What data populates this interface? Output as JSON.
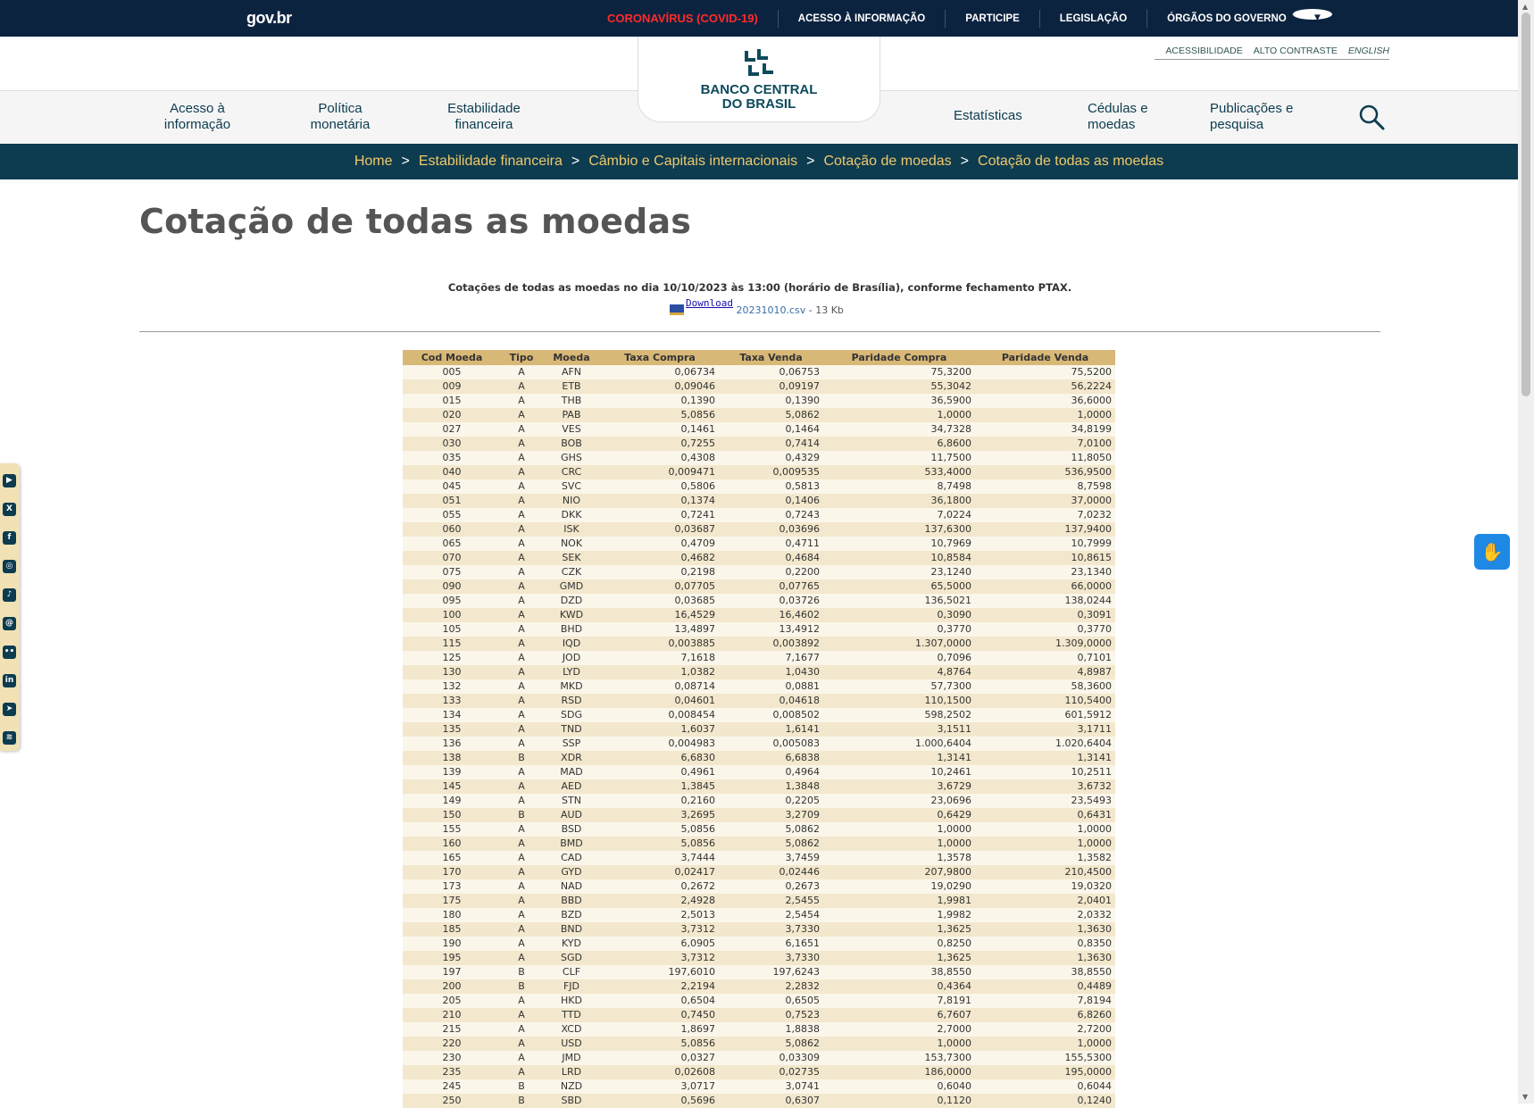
{
  "govbar": {
    "logo": "gov.br",
    "links": [
      "CORONAVÍRUS (COVID-19)",
      "ACESSO À INFORMAÇÃO",
      "PARTICIPE",
      "LEGISLAÇÃO",
      "ÓRGÃOS DO GOVERNO"
    ]
  },
  "accessibility": [
    "ACESSIBILIDADE",
    "ALTO CONTRASTE",
    "ENGLISH"
  ],
  "logo": {
    "line1": "BANCO CENTRAL",
    "line2": "DO BRASIL"
  },
  "nav": {
    "acesso": "Acesso à informação",
    "politica": "Política monetária",
    "estabilidade": "Estabilidade financeira",
    "estatisticas": "Estatísticas",
    "cedulas": "Cédulas e moedas",
    "publicacoes": "Publicações e pesquisa"
  },
  "breadcrumb": [
    "Home",
    "Estabilidade financeira",
    "Câmbio e Capitais internacionais",
    "Cotação de moedas",
    "Cotação de todas as moedas"
  ],
  "page_title": "Cotação de todas as moedas",
  "caption": "Cotações de todas as moedas no dia 10/10/2023 às 13:00 (horário de Brasília), conforme fechamento PTAX.",
  "download": {
    "label": "Download",
    "file": "20231010.csv",
    "size": " - 13 Kb"
  },
  "table": {
    "headers": [
      "Cod Moeda",
      "Tipo",
      "Moeda",
      "Taxa Compra",
      "Taxa Venda",
      "Paridade Compra",
      "Paridade Venda"
    ],
    "rows": [
      [
        "005",
        "A",
        "AFN",
        "0,06734",
        "0,06753",
        "75,3200",
        "75,5200"
      ],
      [
        "009",
        "A",
        "ETB",
        "0,09046",
        "0,09197",
        "55,3042",
        "56,2224"
      ],
      [
        "015",
        "A",
        "THB",
        "0,1390",
        "0,1390",
        "36,5900",
        "36,6000"
      ],
      [
        "020",
        "A",
        "PAB",
        "5,0856",
        "5,0862",
        "1,0000",
        "1,0000"
      ],
      [
        "027",
        "A",
        "VES",
        "0,1461",
        "0,1464",
        "34,7328",
        "34,8199"
      ],
      [
        "030",
        "A",
        "BOB",
        "0,7255",
        "0,7414",
        "6,8600",
        "7,0100"
      ],
      [
        "035",
        "A",
        "GHS",
        "0,4308",
        "0,4329",
        "11,7500",
        "11,8050"
      ],
      [
        "040",
        "A",
        "CRC",
        "0,009471",
        "0,009535",
        "533,4000",
        "536,9500"
      ],
      [
        "045",
        "A",
        "SVC",
        "0,5806",
        "0,5813",
        "8,7498",
        "8,7598"
      ],
      [
        "051",
        "A",
        "NIO",
        "0,1374",
        "0,1406",
        "36,1800",
        "37,0000"
      ],
      [
        "055",
        "A",
        "DKK",
        "0,7241",
        "0,7243",
        "7,0224",
        "7,0232"
      ],
      [
        "060",
        "A",
        "ISK",
        "0,03687",
        "0,03696",
        "137,6300",
        "137,9400"
      ],
      [
        "065",
        "A",
        "NOK",
        "0,4709",
        "0,4711",
        "10,7969",
        "10,7999"
      ],
      [
        "070",
        "A",
        "SEK",
        "0,4682",
        "0,4684",
        "10,8584",
        "10,8615"
      ],
      [
        "075",
        "A",
        "CZK",
        "0,2198",
        "0,2200",
        "23,1240",
        "23,1340"
      ],
      [
        "090",
        "A",
        "GMD",
        "0,07705",
        "0,07765",
        "65,5000",
        "66,0000"
      ],
      [
        "095",
        "A",
        "DZD",
        "0,03685",
        "0,03726",
        "136,5021",
        "138,0244"
      ],
      [
        "100",
        "A",
        "KWD",
        "16,4529",
        "16,4602",
        "0,3090",
        "0,3091"
      ],
      [
        "105",
        "A",
        "BHD",
        "13,4897",
        "13,4912",
        "0,3770",
        "0,3770"
      ],
      [
        "115",
        "A",
        "IQD",
        "0,003885",
        "0,003892",
        "1.307,0000",
        "1.309,0000"
      ],
      [
        "125",
        "A",
        "JOD",
        "7,1618",
        "7,1677",
        "0,7096",
        "0,7101"
      ],
      [
        "130",
        "A",
        "LYD",
        "1,0382",
        "1,0430",
        "4,8764",
        "4,8987"
      ],
      [
        "132",
        "A",
        "MKD",
        "0,08714",
        "0,0881",
        "57,7300",
        "58,3600"
      ],
      [
        "133",
        "A",
        "RSD",
        "0,04601",
        "0,04618",
        "110,1500",
        "110,5400"
      ],
      [
        "134",
        "A",
        "SDG",
        "0,008454",
        "0,008502",
        "598,2502",
        "601,5912"
      ],
      [
        "135",
        "A",
        "TND",
        "1,6037",
        "1,6141",
        "3,1511",
        "3,1711"
      ],
      [
        "136",
        "A",
        "SSP",
        "0,004983",
        "0,005083",
        "1.000,6404",
        "1.020,6404"
      ],
      [
        "138",
        "B",
        "XDR",
        "6,6830",
        "6,6838",
        "1,3141",
        "1,3141"
      ],
      [
        "139",
        "A",
        "MAD",
        "0,4961",
        "0,4964",
        "10,2461",
        "10,2511"
      ],
      [
        "145",
        "A",
        "AED",
        "1,3845",
        "1,3848",
        "3,6729",
        "3,6732"
      ],
      [
        "149",
        "A",
        "STN",
        "0,2160",
        "0,2205",
        "23,0696",
        "23,5493"
      ],
      [
        "150",
        "B",
        "AUD",
        "3,2695",
        "3,2709",
        "0,6429",
        "0,6431"
      ],
      [
        "155",
        "A",
        "BSD",
        "5,0856",
        "5,0862",
        "1,0000",
        "1,0000"
      ],
      [
        "160",
        "A",
        "BMD",
        "5,0856",
        "5,0862",
        "1,0000",
        "1,0000"
      ],
      [
        "165",
        "A",
        "CAD",
        "3,7444",
        "3,7459",
        "1,3578",
        "1,3582"
      ],
      [
        "170",
        "A",
        "GYD",
        "0,02417",
        "0,02446",
        "207,9800",
        "210,4500"
      ],
      [
        "173",
        "A",
        "NAD",
        "0,2672",
        "0,2673",
        "19,0290",
        "19,0320"
      ],
      [
        "175",
        "A",
        "BBD",
        "2,4928",
        "2,5455",
        "1,9981",
        "2,0401"
      ],
      [
        "180",
        "A",
        "BZD",
        "2,5013",
        "2,5454",
        "1,9982",
        "2,0332"
      ],
      [
        "185",
        "A",
        "BND",
        "3,7312",
        "3,7330",
        "1,3625",
        "1,3630"
      ],
      [
        "190",
        "A",
        "KYD",
        "6,0905",
        "6,1651",
        "0,8250",
        "0,8350"
      ],
      [
        "195",
        "A",
        "SGD",
        "3,7312",
        "3,7330",
        "1,3625",
        "1,3630"
      ],
      [
        "197",
        "B",
        "CLF",
        "197,6010",
        "197,6243",
        "38,8550",
        "38,8550"
      ],
      [
        "200",
        "B",
        "FJD",
        "2,2194",
        "2,2832",
        "0,4364",
        "0,4489"
      ],
      [
        "205",
        "A",
        "HKD",
        "0,6504",
        "0,6505",
        "7,8191",
        "7,8194"
      ],
      [
        "210",
        "A",
        "TTD",
        "0,7450",
        "0,7523",
        "6,7607",
        "6,8260"
      ],
      [
        "215",
        "A",
        "XCD",
        "1,8697",
        "1,8838",
        "2,7000",
        "2,7200"
      ],
      [
        "220",
        "A",
        "USD",
        "5,0856",
        "5,0862",
        "1,0000",
        "1,0000"
      ],
      [
        "230",
        "A",
        "JMD",
        "0,0327",
        "0,03309",
        "153,7300",
        "155,5300"
      ],
      [
        "235",
        "A",
        "LRD",
        "0,02608",
        "0,02735",
        "186,0000",
        "195,0000"
      ],
      [
        "245",
        "B",
        "NZD",
        "3,0717",
        "3,0741",
        "0,6040",
        "0,6044"
      ],
      [
        "250",
        "B",
        "SBD",
        "0,5696",
        "0,6307",
        "0,1120",
        "0,1240"
      ]
    ]
  },
  "social_icons": [
    "youtube-icon",
    "x-icon",
    "facebook-icon",
    "instagram-icon",
    "tiktok-icon",
    "threads-icon",
    "flickr-icon",
    "linkedin-icon",
    "telegram-icon",
    "rss-icon"
  ],
  "colors": {
    "govbar": "#0c2340",
    "breadcrumb_bg": "#0d3b4f",
    "breadcrumb_link": "#f0c96b",
    "table_header": "#d8b877",
    "covid": "#ff2b2b"
  }
}
